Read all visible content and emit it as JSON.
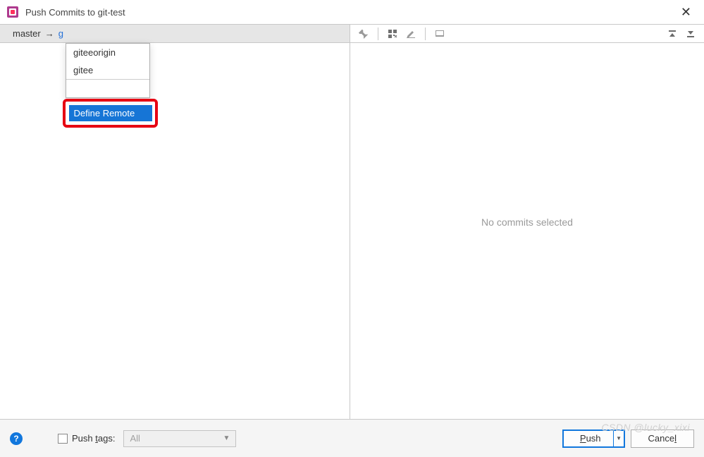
{
  "window": {
    "title": "Push Commits to git-test"
  },
  "branch": {
    "local": "master",
    "arrow": "→",
    "remote_prefix": "g"
  },
  "dropdown": {
    "items": [
      {
        "label": "giteeorigin"
      },
      {
        "label": "gitee"
      }
    ],
    "define_label": "Define Remote"
  },
  "right": {
    "empty_text": "No commits selected"
  },
  "footer": {
    "push_tags_label": "Push tags:",
    "push_tags_underline": "t",
    "combo_value": "All",
    "push_label": "Push",
    "push_underline": "P",
    "cancel_label": "Cancel",
    "cancel_underline": "l"
  },
  "watermark": "CSDN @lucky_xixi"
}
